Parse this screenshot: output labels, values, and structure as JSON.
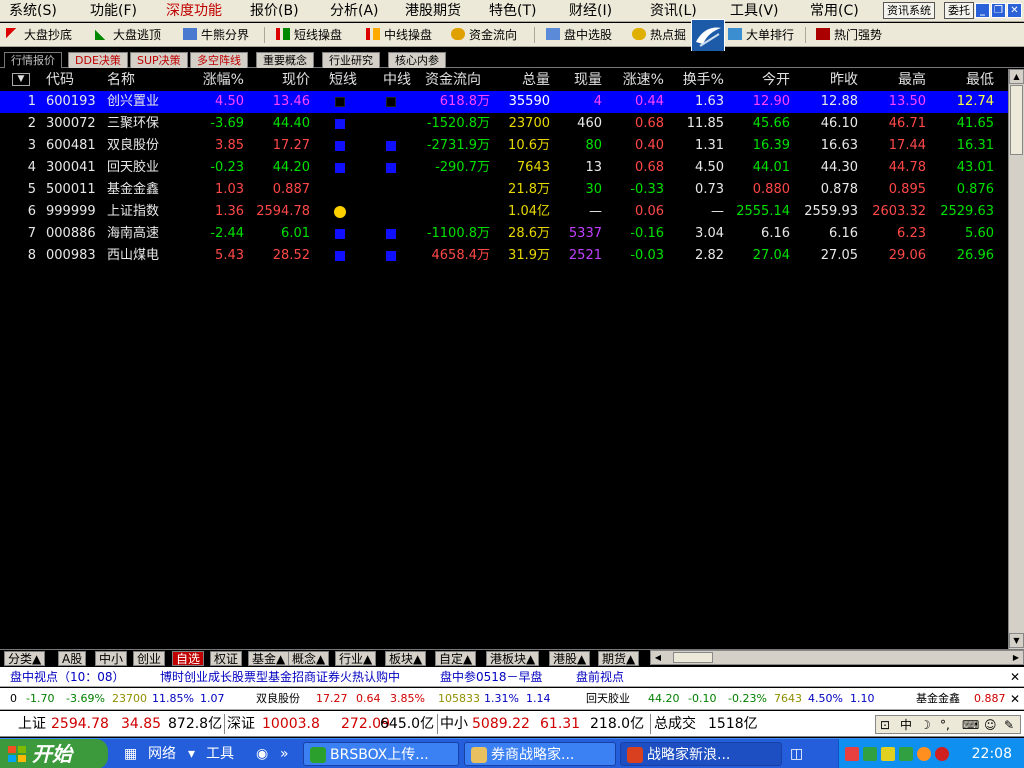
{
  "menu": {
    "items": [
      "系统(S)",
      "功能(F)",
      "深度功能",
      "报价(B)",
      "分析(A)",
      "港股期货",
      "特色(T)",
      "财经(I)",
      "资讯(L)",
      "工具(V)",
      "常用(C)"
    ],
    "active_index": 2,
    "info_system": "资讯系统",
    "trade": "委托"
  },
  "toolbar": {
    "items": [
      "大盘抄底",
      "大盘逃顶",
      "牛熊分界",
      "短线操盘",
      "中线操盘",
      "资金流向",
      "盘中选股",
      "热点掘",
      "大单排行",
      "热门强势"
    ]
  },
  "tabs": [
    "行情报价",
    "DDE决策",
    "SUP决策",
    "多空阵线",
    "重要概念",
    "行业研究",
    "核心内参"
  ],
  "grid": {
    "sort_glyph": "▼",
    "columns": [
      "代码",
      "名称",
      "涨幅%",
      "现价",
      "短线",
      "中线",
      "资金流向",
      "总量",
      "现量",
      "涨速%",
      "换手%",
      "今开",
      "昨收",
      "最高",
      "最低"
    ],
    "rows": [
      {
        "n": "1",
        "code": "600193",
        "name": "创兴置业",
        "chg": "4.50",
        "price": "13.46",
        "short": "dark",
        "mid": "dark",
        "flow": "618.8万",
        "vol": "35590",
        "cur": "4",
        "spd": "0.44",
        "turn": "1.63",
        "open": "12.90",
        "prev": "12.88",
        "high": "13.50",
        "low": "12.74"
      },
      {
        "n": "2",
        "code": "300072",
        "name": "三聚环保",
        "chg": "-3.69",
        "price": "44.40",
        "short": "blue",
        "mid": "",
        "flow": "-1520.8万",
        "vol": "23700",
        "cur": "460",
        "spd": "0.68",
        "turn": "11.85",
        "open": "45.66",
        "prev": "46.10",
        "high": "46.71",
        "low": "41.65"
      },
      {
        "n": "3",
        "code": "600481",
        "name": "双良股份",
        "chg": "3.85",
        "price": "17.27",
        "short": "blue",
        "mid": "blue",
        "flow": "-2731.9万",
        "vol": "10.6万",
        "cur": "80",
        "spd": "0.40",
        "turn": "1.31",
        "open": "16.39",
        "prev": "16.63",
        "high": "17.44",
        "low": "16.31"
      },
      {
        "n": "4",
        "code": "300041",
        "name": "回天胶业",
        "chg": "-0.23",
        "price": "44.20",
        "short": "blue",
        "mid": "blue",
        "flow": "-290.7万",
        "vol": "7643",
        "cur": "13",
        "spd": "0.68",
        "turn": "4.50",
        "open": "44.01",
        "prev": "44.30",
        "high": "44.78",
        "low": "43.01"
      },
      {
        "n": "5",
        "code": "500011",
        "name": "基金金鑫",
        "chg": "1.03",
        "price": "0.887",
        "short": "",
        "mid": "",
        "flow": "",
        "vol": "21.8万",
        "cur": "30",
        "spd": "-0.33",
        "turn": "0.73",
        "open": "0.880",
        "prev": "0.878",
        "high": "0.895",
        "low": "0.876"
      },
      {
        "n": "6",
        "code": "999999",
        "name": "上证指数",
        "chg": "1.36",
        "price": "2594.78",
        "short": "dot",
        "mid": "",
        "flow": "",
        "vol": "1.04亿",
        "cur": "—",
        "spd": "0.06",
        "turn": "—",
        "open": "2555.14",
        "prev": "2559.93",
        "high": "2603.32",
        "low": "2529.63"
      },
      {
        "n": "7",
        "code": "000886",
        "name": "海南高速",
        "chg": "-2.44",
        "price": "6.01",
        "short": "blue",
        "mid": "blue",
        "flow": "-1100.8万",
        "vol": "28.6万",
        "cur": "5337",
        "spd": "-0.16",
        "turn": "3.04",
        "open": "6.16",
        "prev": "6.16",
        "high": "6.23",
        "low": "5.60"
      },
      {
        "n": "8",
        "code": "000983",
        "name": "西山煤电",
        "chg": "5.43",
        "price": "28.52",
        "short": "blue",
        "mid": "blue",
        "flow": "4658.4万",
        "vol": "31.9万",
        "cur": "2521",
        "spd": "-0.03",
        "turn": "2.82",
        "open": "27.04",
        "prev": "27.05",
        "high": "29.06",
        "low": "26.96"
      }
    ]
  },
  "categories": [
    "分类▲",
    "A股",
    "中小",
    "创业",
    "自选",
    "权证",
    "基金▲",
    "概念▲",
    "行业▲",
    "板块▲",
    "自定▲",
    "港板块▲",
    "港股▲",
    "期货▲"
  ],
  "categories_selected": 4,
  "news": {
    "items": [
      "盘中视点（10：08）",
      "博时创业成长股票型基金招商证券火热认购中",
      "盘中参0518－早盘",
      "盘前视点"
    ]
  },
  "ticker": {
    "items": [
      {
        "text": "0",
        "c": "blk"
      },
      {
        "text": "-1.70",
        "c": "grn"
      },
      {
        "text": "-3.69%",
        "c": "grn"
      },
      {
        "text": "23700",
        "c": "gry"
      },
      {
        "text": "11.85%",
        "c": "blu"
      },
      {
        "text": "1.07",
        "c": "blu"
      },
      {
        "text": "双良股份",
        "c": "blk"
      },
      {
        "text": "17.27",
        "c": "red"
      },
      {
        "text": "0.64",
        "c": "red"
      },
      {
        "text": "3.85%",
        "c": "red"
      },
      {
        "text": "105833",
        "c": "gry"
      },
      {
        "text": "1.31%",
        "c": "blu"
      },
      {
        "text": "1.14",
        "c": "blu"
      },
      {
        "text": "回天胶业",
        "c": "blk"
      },
      {
        "text": "44.20",
        "c": "grn"
      },
      {
        "text": "-0.10",
        "c": "grn"
      },
      {
        "text": "-0.23%",
        "c": "grn"
      },
      {
        "text": "7643",
        "c": "gry"
      },
      {
        "text": "4.50%",
        "c": "blu"
      },
      {
        "text": "1.10",
        "c": "blu"
      },
      {
        "text": "基金金鑫",
        "c": "blk"
      },
      {
        "text": "0.887",
        "c": "red"
      }
    ]
  },
  "status": {
    "sh_label": "上证",
    "sh_value": "2594.78",
    "sh_change": "34.85",
    "sh_amount": "872.8亿",
    "sz_label": "深证",
    "sz_value": "10003.8",
    "sz_change": "272.09",
    "sz_amount": "645.0亿",
    "zx_label": "中小",
    "zx_value": "5089.22",
    "zx_change": "61.31",
    "zx_amount": "218.0亿",
    "total_label": "总成交",
    "total_value": "1518亿"
  },
  "ime": {
    "mode": "中"
  },
  "taskbar": {
    "start": "开始",
    "quick": [
      "网络",
      "工具"
    ],
    "tasks": [
      "BRSBOX上传...",
      "券商战略家...",
      "战略家新浪..."
    ],
    "active_task": 2,
    "clock": "22:08"
  },
  "colors": {
    "up": "#ff4848",
    "down": "#00e000",
    "volume": "#e8d800",
    "selected_row": "#0000ff",
    "taskbar": "#245edb"
  }
}
